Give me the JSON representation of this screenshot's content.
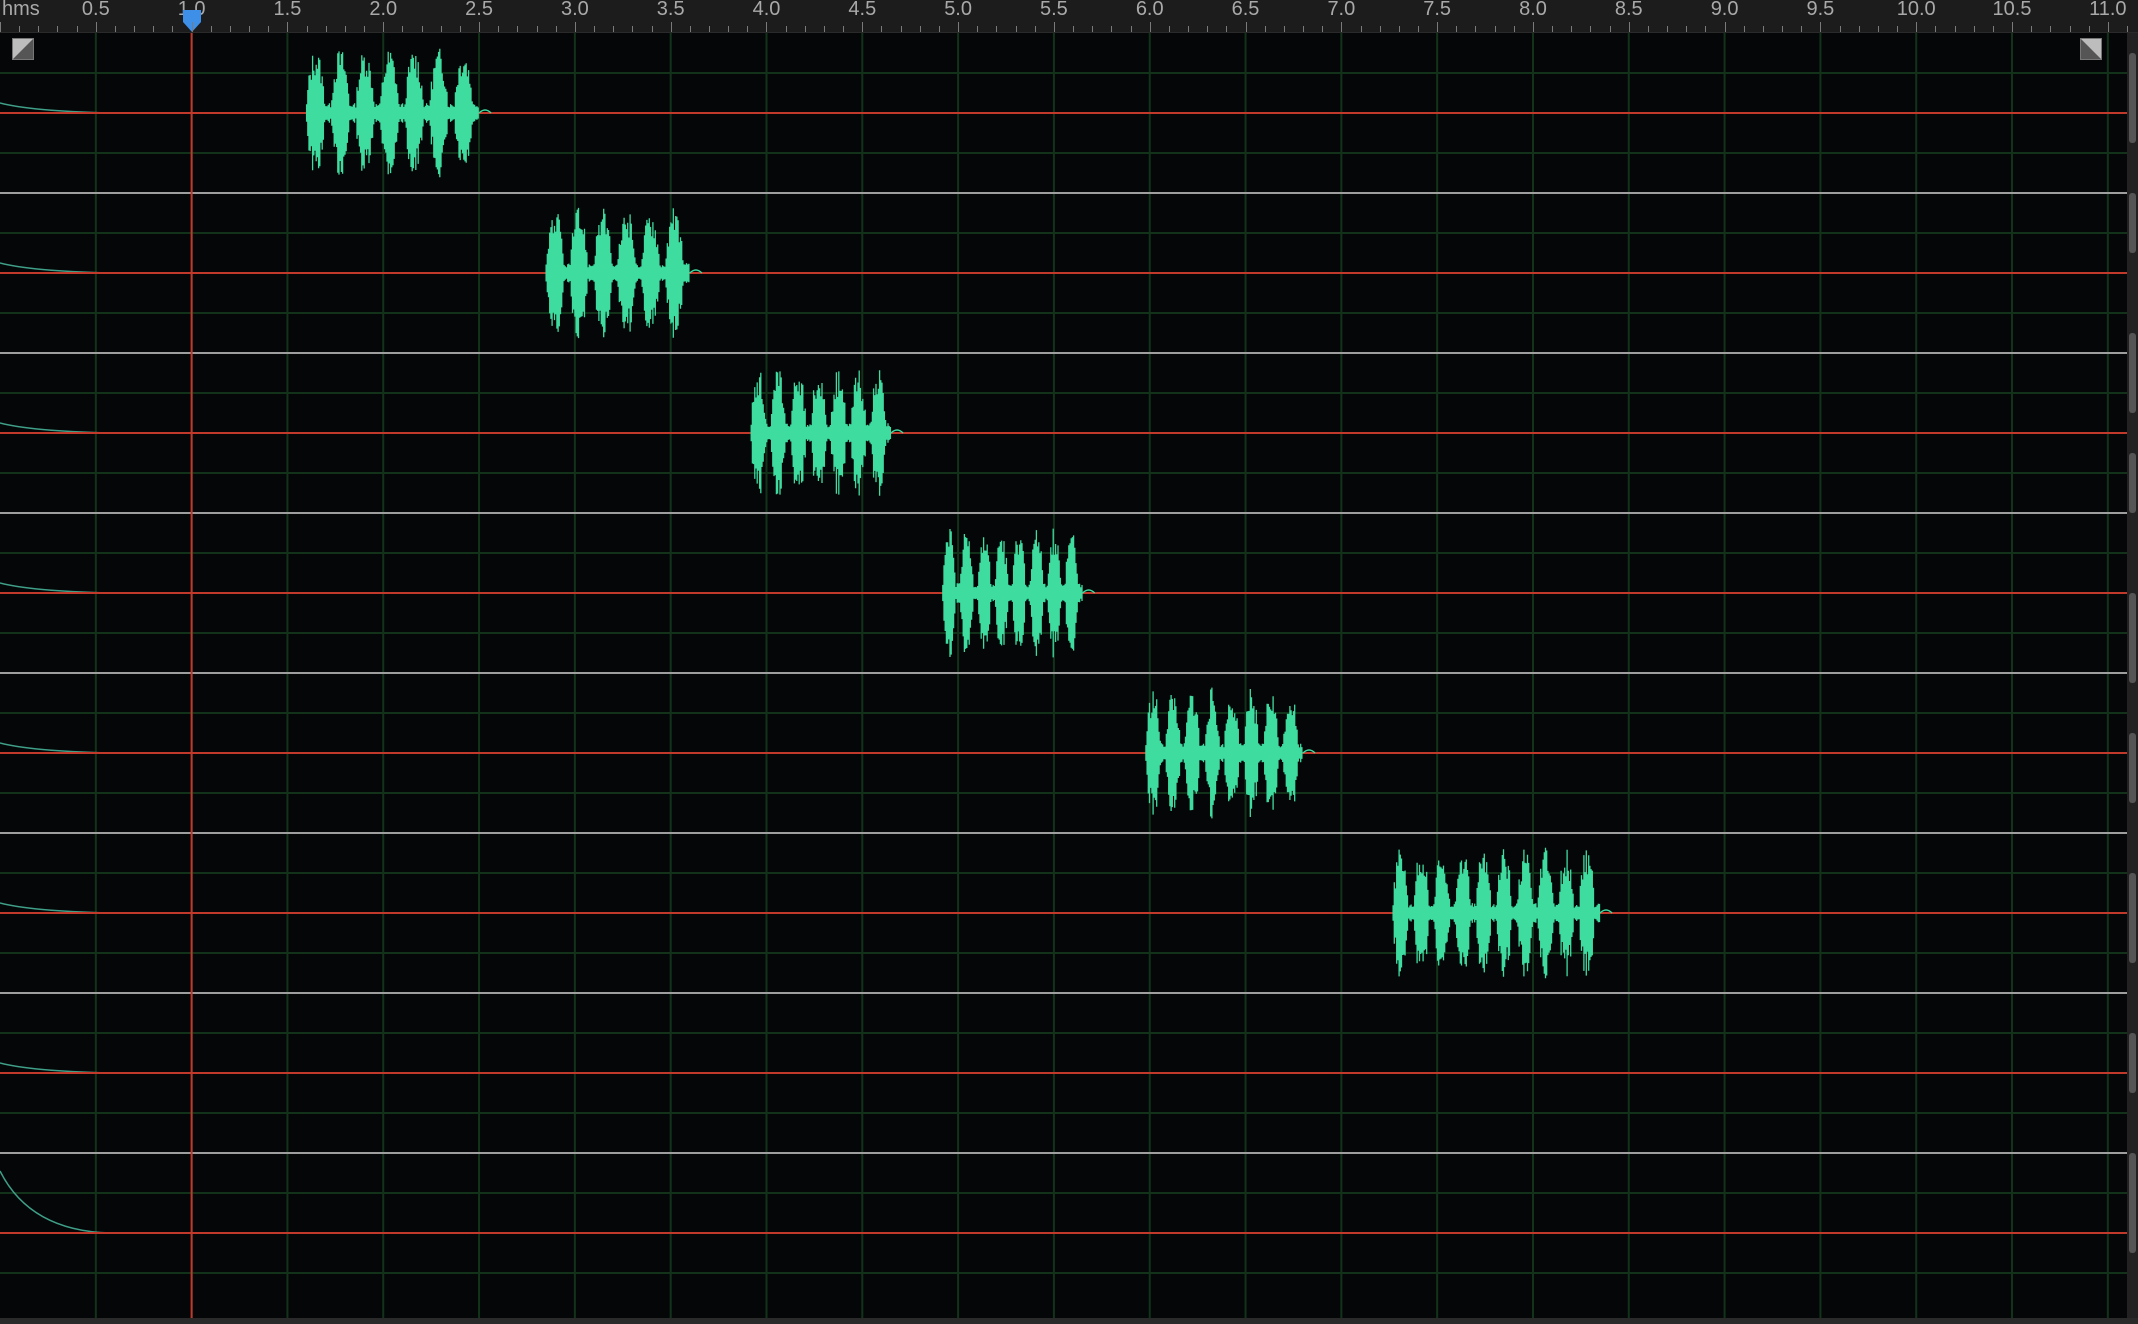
{
  "ruler": {
    "units_label": "hms",
    "labels": [
      "0.5",
      "1.0",
      "1.5",
      "2.0",
      "2.5",
      "3.0",
      "3.5",
      "4.0",
      "4.5",
      "5.0",
      "5.5",
      "6.0",
      "6.5",
      "7.0",
      "7.5",
      "8.0",
      "8.5",
      "9.0",
      "9.5",
      "10.0",
      "10.5",
      "11.0"
    ]
  },
  "timeline": {
    "start": 0.0,
    "end": 11.1,
    "playhead_time": 1.0
  },
  "channels": [
    {
      "burst_start": 1.6,
      "burst_end": 2.5,
      "pulses": 7
    },
    {
      "burst_start": 2.85,
      "burst_end": 3.6,
      "pulses": 6
    },
    {
      "burst_start": 3.92,
      "burst_end": 4.65,
      "pulses": 7
    },
    {
      "burst_start": 4.92,
      "burst_end": 5.65,
      "pulses": 8
    },
    {
      "burst_start": 5.98,
      "burst_end": 6.8,
      "pulses": 8
    },
    {
      "burst_start": 7.27,
      "burst_end": 8.35,
      "pulses": 10
    },
    {
      "burst_start": null,
      "burst_end": null,
      "pulses": 0
    },
    {
      "burst_start": null,
      "burst_end": null,
      "pulses": 0
    }
  ],
  "colors": {
    "background": "#050608",
    "grid": "#12331a",
    "center_line": "#c0392b",
    "separator": "#9e9e9e",
    "waveform": "#3fdca0",
    "playhead": "#c0392b",
    "playhead_handle": "#3d8fe8",
    "ruler_text": "#a9a9a9"
  },
  "icons": {
    "fade_in": "fade-in-handle-icon",
    "fade_out": "fade-out-handle-icon",
    "playhead": "playhead-marker-icon"
  }
}
